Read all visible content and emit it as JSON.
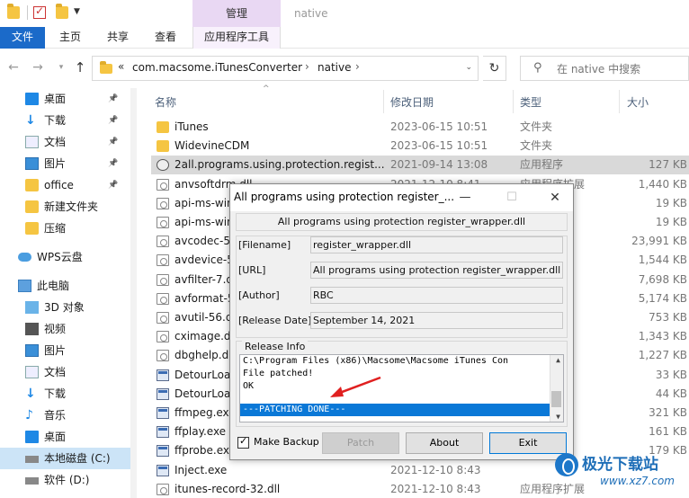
{
  "title_bar": {
    "context_tab": "管理",
    "window_title": "native"
  },
  "ribbon": {
    "tabs": [
      "文件",
      "主页",
      "共享",
      "查看",
      "应用程序工具"
    ]
  },
  "address": {
    "chevron": "«",
    "parts": [
      "com.macsome.iTunesConverter",
      "native"
    ],
    "separator": "›"
  },
  "search": {
    "placeholder": "在 native 中搜索"
  },
  "sidebar": {
    "items": [
      {
        "label": "桌面",
        "icon": "desktop-icon",
        "pinned": true
      },
      {
        "label": "下载",
        "icon": "download-icon",
        "pinned": true
      },
      {
        "label": "文档",
        "icon": "documents-icon",
        "pinned": true
      },
      {
        "label": "图片",
        "icon": "pictures-icon",
        "pinned": true
      },
      {
        "label": "office",
        "icon": "folder-icon",
        "pinned": true
      },
      {
        "label": "新建文件夹",
        "icon": "folder-icon",
        "pinned": false
      },
      {
        "label": "压缩",
        "icon": "folder-icon",
        "pinned": false
      },
      {
        "label": "WPS云盘",
        "icon": "cloud-icon",
        "pinned": false
      },
      {
        "label": "此电脑",
        "icon": "computer-icon",
        "pinned": false
      },
      {
        "label": "3D 对象",
        "icon": "3d-objects-icon",
        "pinned": false
      },
      {
        "label": "视频",
        "icon": "video-icon",
        "pinned": false
      },
      {
        "label": "图片",
        "icon": "pictures-icon",
        "pinned": false
      },
      {
        "label": "文档",
        "icon": "documents-icon",
        "pinned": false
      },
      {
        "label": "下载",
        "icon": "download-icon",
        "pinned": false
      },
      {
        "label": "音乐",
        "icon": "music-icon",
        "pinned": false
      },
      {
        "label": "桌面",
        "icon": "desktop-icon",
        "pinned": false
      },
      {
        "label": "本地磁盘 (C:)",
        "icon": "drive-icon",
        "pinned": false,
        "selected": true
      },
      {
        "label": "软件 (D:)",
        "icon": "drive-icon",
        "pinned": false
      }
    ]
  },
  "filelist": {
    "columns": [
      "名称",
      "修改日期",
      "类型",
      "大小"
    ],
    "rows": [
      {
        "name": "iTunes",
        "date": "2023-06-15 10:51",
        "type": "文件夹",
        "size": "",
        "icon": "folder"
      },
      {
        "name": "WidevineCDM",
        "date": "2023-06-15 10:51",
        "type": "文件夹",
        "size": "",
        "icon": "folder"
      },
      {
        "name": "2all.programs.using.protection.regist...",
        "date": "2021-09-14 13:08",
        "type": "应用程序",
        "size": "127 KB",
        "icon": "gear",
        "selected": true
      },
      {
        "name": "anvsoftdrm.dll",
        "date": "2021-12-10 8:41",
        "type": "应用程序扩展",
        "size": "1,440 KB",
        "icon": "dll"
      },
      {
        "name": "api-ms-win",
        "date": "",
        "type": "展",
        "size": "19 KB",
        "icon": "dll"
      },
      {
        "name": "api-ms-win",
        "date": "",
        "type": "展",
        "size": "19 KB",
        "icon": "dll"
      },
      {
        "name": "avcodec-5",
        "date": "",
        "type": "展",
        "size": "23,991 KB",
        "icon": "dll"
      },
      {
        "name": "avdevice-5",
        "date": "",
        "type": "展",
        "size": "1,544 KB",
        "icon": "dll"
      },
      {
        "name": "avfilter-7.dl",
        "date": "",
        "type": "展",
        "size": "7,698 KB",
        "icon": "dll"
      },
      {
        "name": "avformat-5",
        "date": "",
        "type": "展",
        "size": "5,174 KB",
        "icon": "dll"
      },
      {
        "name": "avutil-56.dl",
        "date": "",
        "type": "展",
        "size": "753 KB",
        "icon": "dll"
      },
      {
        "name": "cximage.dl",
        "date": "",
        "type": "展",
        "size": "1,343 KB",
        "icon": "dll"
      },
      {
        "name": "dbghelp.dl",
        "date": "",
        "type": "展",
        "size": "1,227 KB",
        "icon": "dll"
      },
      {
        "name": "DetourLoa",
        "date": "",
        "type": "",
        "size": "33 KB",
        "icon": "exe"
      },
      {
        "name": "DetourLoa",
        "date": "",
        "type": "",
        "size": "44 KB",
        "icon": "exe"
      },
      {
        "name": "ffmpeg.exe",
        "date": "",
        "type": "",
        "size": "321 KB",
        "icon": "exe"
      },
      {
        "name": "ffplay.exe",
        "date": "",
        "type": "",
        "size": "161 KB",
        "icon": "exe"
      },
      {
        "name": "ffprobe.exe",
        "date": "",
        "type": "",
        "size": "179 KB",
        "icon": "exe"
      },
      {
        "name": "Inject.exe",
        "date": "2021-12-10 8:43",
        "type": "",
        "size": "",
        "icon": "exe"
      },
      {
        "name": "itunes-record-32.dll",
        "date": "2021-12-10 8:43",
        "type": "应用程序扩展",
        "size": "",
        "icon": "dll"
      }
    ]
  },
  "dialog": {
    "title": "All programs using protection register_...",
    "banner": "All programs using protection register_wrapper.dll",
    "fields": [
      {
        "label": "[Filename]",
        "value": "register_wrapper.dll"
      },
      {
        "label": "[URL]",
        "value": "All programs using protection register_wrapper.dll"
      },
      {
        "label": "[Author]",
        "value": "RBC"
      },
      {
        "label": "[Release Date]",
        "value": "September 14, 2021"
      }
    ],
    "release_info_title": "Release Info",
    "release_lines": [
      "C:\\Program Files (x86)\\Macsome\\Macsome iTunes Con",
      "File patched!",
      "OK",
      "",
      "---PATCHING DONE---"
    ],
    "make_backup_label": "Make Backup",
    "make_backup_checked": true,
    "buttons": {
      "patch": "Patch",
      "about": "About",
      "exit": "Exit"
    }
  },
  "watermark": {
    "name": "极光下载站",
    "url": "www.xz7.com"
  },
  "colors": {
    "accent": "#1b6ac9",
    "context_tab": "#e9d8f3",
    "selection": "#0a78d7",
    "arrow": "#e02020"
  }
}
